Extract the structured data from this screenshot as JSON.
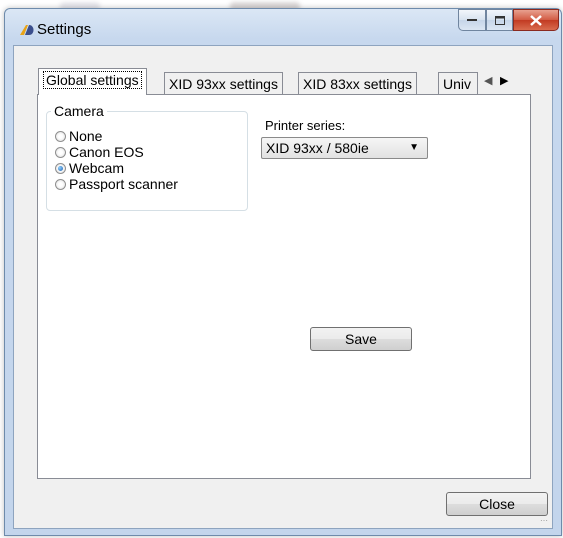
{
  "window": {
    "title": "Settings"
  },
  "tabs": [
    {
      "label": "Global settings",
      "active": true
    },
    {
      "label": "XID 93xx settings",
      "active": false
    },
    {
      "label": "XID 83xx settings",
      "active": false
    },
    {
      "label": "Univ",
      "active": false
    }
  ],
  "tab_scroll": {
    "left_icon": "arrow-left-icon",
    "right_icon": "arrow-right-icon"
  },
  "camera_group": {
    "legend": "Camera",
    "options": [
      {
        "label": "None",
        "checked": false
      },
      {
        "label": "Canon EOS",
        "checked": false
      },
      {
        "label": "Webcam",
        "checked": true
      },
      {
        "label": "Passport scanner",
        "checked": false
      }
    ]
  },
  "printer": {
    "label": "Printer series:",
    "selected": "XID 93xx / 580ie"
  },
  "buttons": {
    "save": "Save",
    "close": "Close"
  },
  "colors": {
    "titlebar": "#c7d8ee",
    "close_button": "#c23a22"
  }
}
